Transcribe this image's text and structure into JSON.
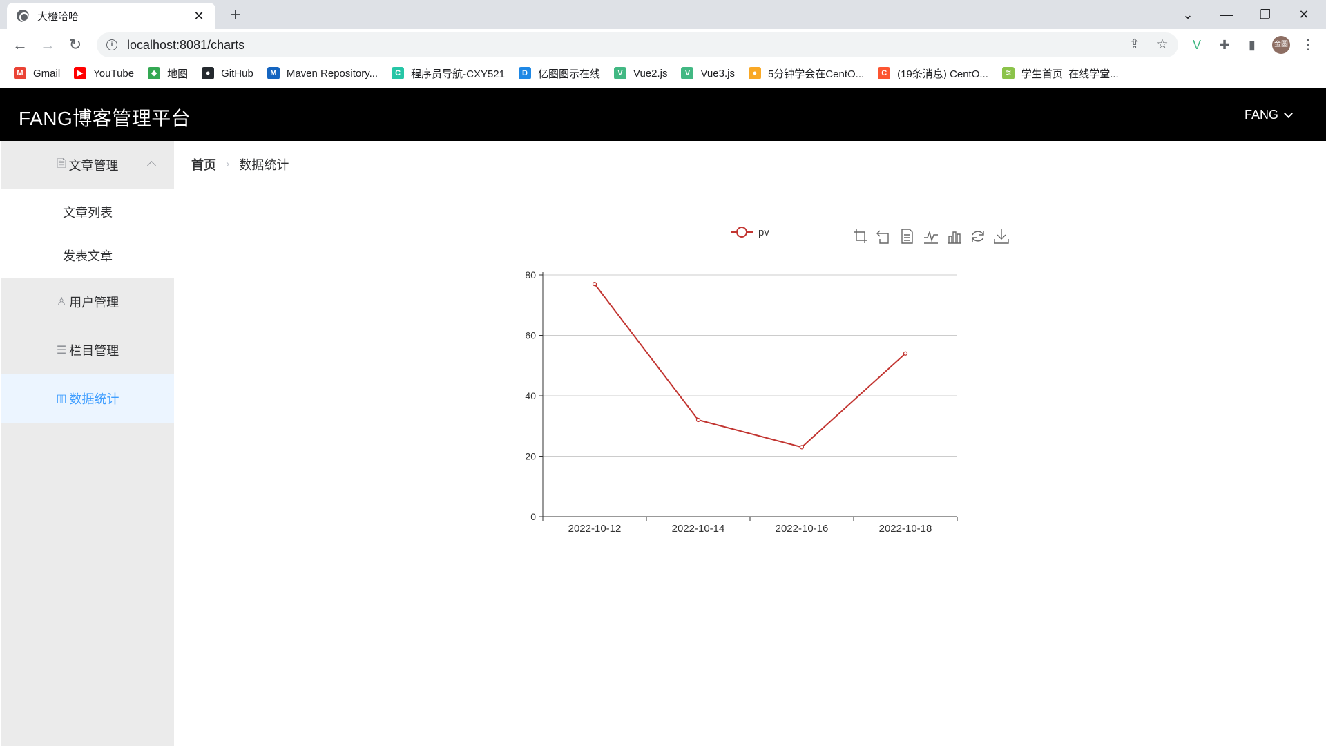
{
  "browser": {
    "tab_title": "大橙哈哈",
    "tab_close": "✕",
    "new_tab": "+",
    "url": "localhost:8081/charts",
    "profile_text": "金圆",
    "bookmarks": [
      {
        "label": "Gmail",
        "icon": "gmail-icon",
        "color": "#ea4335",
        "glyph": "M"
      },
      {
        "label": "YouTube",
        "icon": "youtube-icon",
        "color": "#ff0000",
        "glyph": "▶"
      },
      {
        "label": "地图",
        "icon": "maps-icon",
        "color": "#34a853",
        "glyph": "◆"
      },
      {
        "label": "GitHub",
        "icon": "github-icon",
        "color": "#24292e",
        "glyph": "●"
      },
      {
        "label": "Maven Repository...",
        "icon": "maven-icon",
        "color": "#1565c0",
        "glyph": "M"
      },
      {
        "label": "程序员导航-CXY521",
        "icon": "cxy-icon",
        "color": "#26c6a6",
        "glyph": "C"
      },
      {
        "label": "亿图图示在线",
        "icon": "edraw-icon",
        "color": "#1e88e5",
        "glyph": "D"
      },
      {
        "label": "Vue2.js",
        "icon": "vue-icon",
        "color": "#42b883",
        "glyph": "V"
      },
      {
        "label": "Vue3.js",
        "icon": "vue-icon",
        "color": "#42b883",
        "glyph": "V"
      },
      {
        "label": "5分钟学会在CentO...",
        "icon": "site-icon",
        "color": "#f9a825",
        "glyph": "●"
      },
      {
        "label": "(19条消息) CentO...",
        "icon": "csdn-icon",
        "color": "#fc5531",
        "glyph": "C"
      },
      {
        "label": "学生首页_在线学堂...",
        "icon": "school-icon",
        "color": "#8bc34a",
        "glyph": "≋"
      }
    ]
  },
  "header": {
    "title": "FANG博客管理平台",
    "user": "FANG"
  },
  "sidebar": {
    "article_mgmt": "文章管理",
    "article_list": "文章列表",
    "publish_article": "发表文章",
    "user_mgmt": "用户管理",
    "column_mgmt": "栏目管理",
    "data_stats": "数据统计"
  },
  "breadcrumb": {
    "home": "首页",
    "current": "数据统计"
  },
  "chart_data": {
    "type": "line",
    "x": [
      "2022-10-12",
      "2022-10-14",
      "2022-10-16",
      "2022-10-18"
    ],
    "series": [
      {
        "name": "pv",
        "values": [
          77,
          32,
          23,
          54
        ],
        "color": "#c23531"
      }
    ],
    "ylim": [
      0,
      80
    ],
    "yticks": [
      0,
      20,
      40,
      60,
      80
    ],
    "grid": true,
    "legend": "top-center",
    "toolbox": [
      "zoom-icon",
      "zoom-reset-icon",
      "data-view-icon",
      "line-chart-icon",
      "bar-chart-icon",
      "restore-icon",
      "download-icon"
    ]
  }
}
